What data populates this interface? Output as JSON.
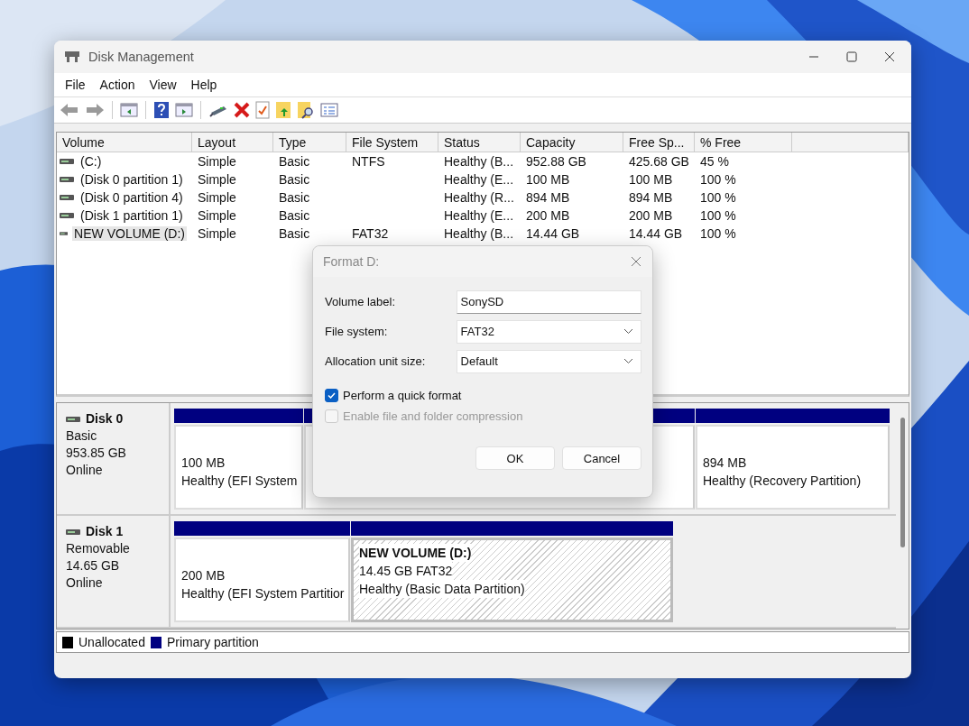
{
  "window": {
    "title": "Disk Management"
  },
  "menu": [
    "File",
    "Action",
    "View",
    "Help"
  ],
  "table": {
    "columns": [
      "Volume",
      "Layout",
      "Type",
      "File System",
      "Status",
      "Capacity",
      "Free Sp...",
      "% Free"
    ],
    "rows": [
      {
        "cells": [
          "(C:)",
          "Simple",
          "Basic",
          "NTFS",
          "Healthy (B...",
          "952.88 GB",
          "425.68 GB",
          "45 %"
        ],
        "selected": false
      },
      {
        "cells": [
          "(Disk 0 partition 1)",
          "Simple",
          "Basic",
          "",
          "Healthy (E...",
          "100 MB",
          "100 MB",
          "100 %"
        ],
        "selected": false
      },
      {
        "cells": [
          "(Disk 0 partition 4)",
          "Simple",
          "Basic",
          "",
          "Healthy (R...",
          "894 MB",
          "894 MB",
          "100 %"
        ],
        "selected": false
      },
      {
        "cells": [
          "(Disk 1 partition 1)",
          "Simple",
          "Basic",
          "",
          "Healthy (E...",
          "200 MB",
          "200 MB",
          "100 %"
        ],
        "selected": false
      },
      {
        "cells": [
          "NEW VOLUME (D:)",
          "Simple",
          "Basic",
          "FAT32",
          "Healthy (B...",
          "14.44 GB",
          "14.44 GB",
          "100 %"
        ],
        "selected": true
      }
    ]
  },
  "disks": [
    {
      "name": "Disk 0",
      "type": "Basic",
      "size": "953.85 GB",
      "status": "Online",
      "partitions": [
        {
          "kind": "plain",
          "lines": [
            "100 MB",
            "Healthy (EFI System"
          ]
        },
        {
          "kind": "plain"
        },
        {
          "kind": "plain",
          "lines": [
            "894 MB",
            "Healthy (Recovery Partition)"
          ]
        }
      ]
    },
    {
      "name": "Disk 1",
      "type": "Removable",
      "size": "14.65 GB",
      "status": "Online",
      "partitions": [
        {
          "kind": "plain",
          "lines": [
            "200 MB",
            "Healthy (EFI System Partitior"
          ]
        },
        {
          "kind": "hatched",
          "title": "NEW VOLUME  (D:)",
          "lines": [
            "14.45 GB FAT32",
            "Healthy (Basic Data Partition)"
          ]
        }
      ]
    }
  ],
  "legend": [
    {
      "label": "Unallocated",
      "color": "#000000"
    },
    {
      "label": "Primary partition",
      "color": "#000080"
    }
  ],
  "dialog": {
    "title": "Format D:",
    "fields": [
      {
        "label": "Volume label:",
        "kind": "text",
        "value": "SonySD"
      },
      {
        "label": "File system:",
        "kind": "select",
        "value": "FAT32"
      },
      {
        "label": "Allocation unit size:",
        "kind": "select",
        "value": "Default"
      }
    ],
    "checkboxes": [
      {
        "label": "Perform a quick format",
        "checked": true,
        "disabled": false
      },
      {
        "label": "Enable file and folder compression",
        "checked": false,
        "disabled": true
      }
    ],
    "buttons": [
      "OK",
      "Cancel"
    ]
  }
}
